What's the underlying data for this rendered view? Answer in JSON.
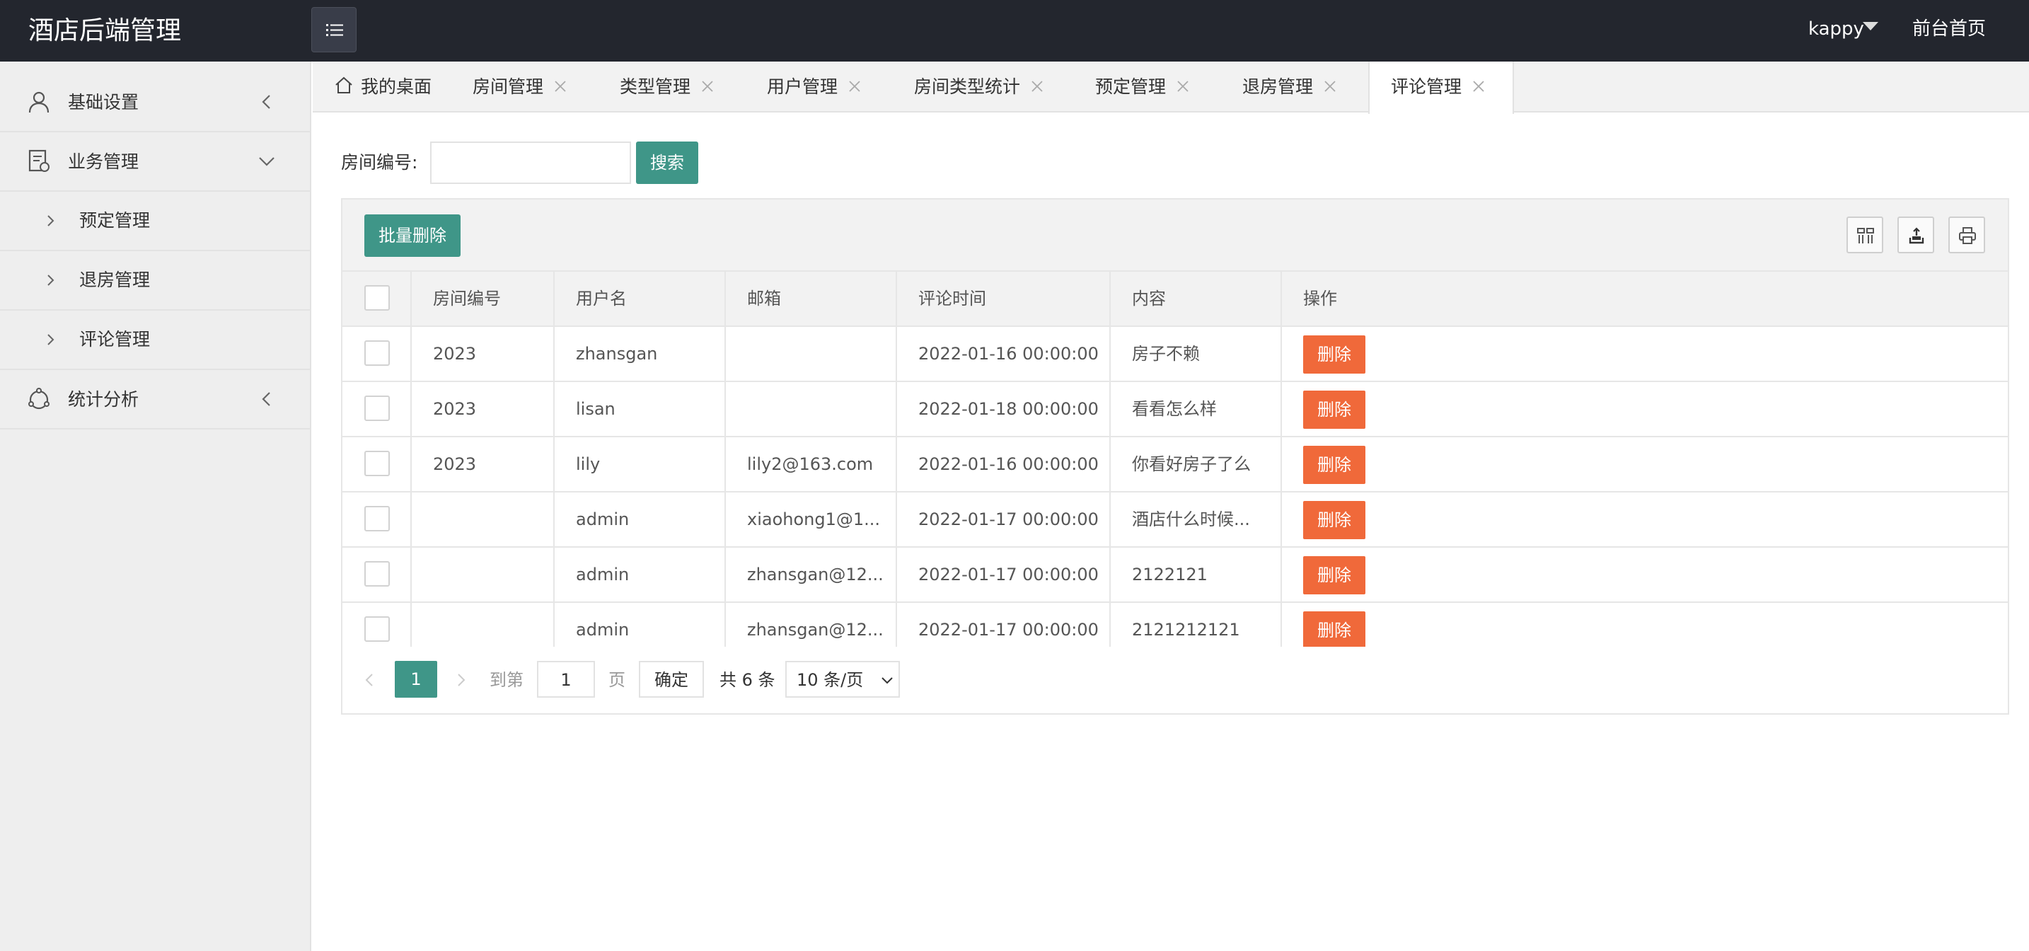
{
  "app": {
    "title": "酒店后端管理"
  },
  "header": {
    "user": "kappy",
    "front_link": "前台首页"
  },
  "sidebar": {
    "items": [
      {
        "label": "基础设置",
        "icon": "user-icon",
        "state": "collapsed"
      },
      {
        "label": "业务管理",
        "icon": "document-icon",
        "state": "expanded",
        "children": [
          {
            "label": "预定管理"
          },
          {
            "label": "退房管理"
          },
          {
            "label": "评论管理"
          }
        ]
      },
      {
        "label": "统计分析",
        "icon": "chart-icon",
        "state": "collapsed"
      }
    ]
  },
  "tabs": [
    {
      "label": "我的桌面",
      "closable": false
    },
    {
      "label": "房间管理",
      "closable": true
    },
    {
      "label": "类型管理",
      "closable": true
    },
    {
      "label": "用户管理",
      "closable": true
    },
    {
      "label": "房间类型统计",
      "closable": true
    },
    {
      "label": "预定管理",
      "closable": true
    },
    {
      "label": "退房管理",
      "closable": true
    },
    {
      "label": "评论管理",
      "closable": true,
      "active": true
    }
  ],
  "search": {
    "label": "房间编号:",
    "value": "",
    "placeholder": "",
    "button": "搜索"
  },
  "toolbar": {
    "batch_delete": "批量删除",
    "icons": [
      "columns-icon",
      "export-icon",
      "print-icon"
    ]
  },
  "table": {
    "headers": [
      "房间编号",
      "用户名",
      "邮箱",
      "评论时间",
      "内容",
      "操作"
    ],
    "rows": [
      {
        "room": "2023",
        "user": "zhansgan",
        "email": "",
        "time": "2022-01-16 00:00:00",
        "content": "房子不赖",
        "action": "删除"
      },
      {
        "room": "2023",
        "user": "lisan",
        "email": "",
        "time": "2022-01-18 00:00:00",
        "content": "看看怎么样",
        "action": "删除"
      },
      {
        "room": "2023",
        "user": "lily",
        "email": "lily2@163.com",
        "time": "2022-01-16 00:00:00",
        "content": "你看好房子了么",
        "action": "删除"
      },
      {
        "room": "",
        "user": "admin",
        "email": "xiaohong1@1...",
        "time": "2022-01-17 00:00:00",
        "content": "酒店什么时候...",
        "action": "删除"
      },
      {
        "room": "",
        "user": "admin",
        "email": "zhansgan@12...",
        "time": "2022-01-17 00:00:00",
        "content": "2122121",
        "action": "删除"
      },
      {
        "room": "",
        "user": "admin",
        "email": "zhansgan@12...",
        "time": "2022-01-17 00:00:00",
        "content": "2121212121",
        "action": "删除"
      }
    ]
  },
  "pagination": {
    "current": "1",
    "goto_label": "到第",
    "goto_value": "1",
    "page_unit": "页",
    "confirm": "确定",
    "total": "共 6 条",
    "page_size": "10 条/页"
  },
  "colors": {
    "topbar": "#23262e",
    "accent": "#3f9688",
    "danger": "#f0693a"
  }
}
